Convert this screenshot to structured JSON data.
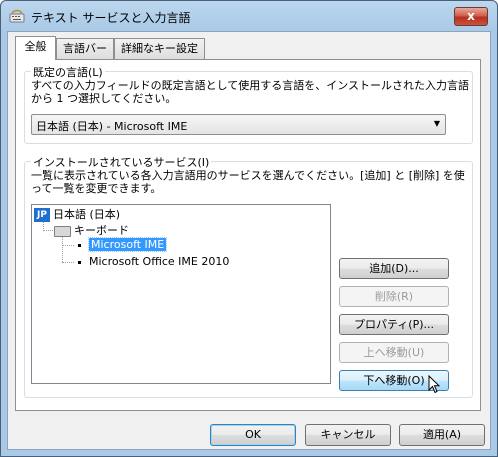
{
  "window": {
    "title": "テキスト サービスと入力言語",
    "close_label": "x"
  },
  "tabs": [
    {
      "label": "全般",
      "active": true
    },
    {
      "label": "言語バー",
      "active": false
    },
    {
      "label": "詳細なキー設定",
      "active": false
    }
  ],
  "default_language": {
    "group_label": "既定の言語(L)",
    "description_line1": "すべての入力フィールドの既定言語として使用する言語を、インストールされた入力言語",
    "description_line2": "から 1 つ選択してください。",
    "selected_value": "日本語 (日本) - Microsoft IME"
  },
  "installed_services": {
    "group_label": "インストールされているサービス(I)",
    "description_line1": "一覧に表示されている各入力言語用のサービスを選んでください。[追加] と [削除] を使",
    "description_line2": "って一覧を変更できます。",
    "tree": {
      "language_badge": "JP",
      "language": "日本語 (日本)",
      "category": "キーボード",
      "items": [
        "Microsoft IME",
        "Microsoft Office IME 2010"
      ],
      "selected_index": 0
    },
    "buttons": {
      "add": "追加(D)...",
      "remove": "削除(R)",
      "properties": "プロパティ(P)...",
      "move_up": "上へ移動(U)",
      "move_down": "下へ移動(O)"
    }
  },
  "footer_buttons": {
    "ok": "OK",
    "cancel": "キャンセル",
    "apply": "適用(A)"
  },
  "colors": {
    "selection": "#3399ff",
    "close_button": "#c9533f",
    "title_bar": "#a9c9e6"
  }
}
